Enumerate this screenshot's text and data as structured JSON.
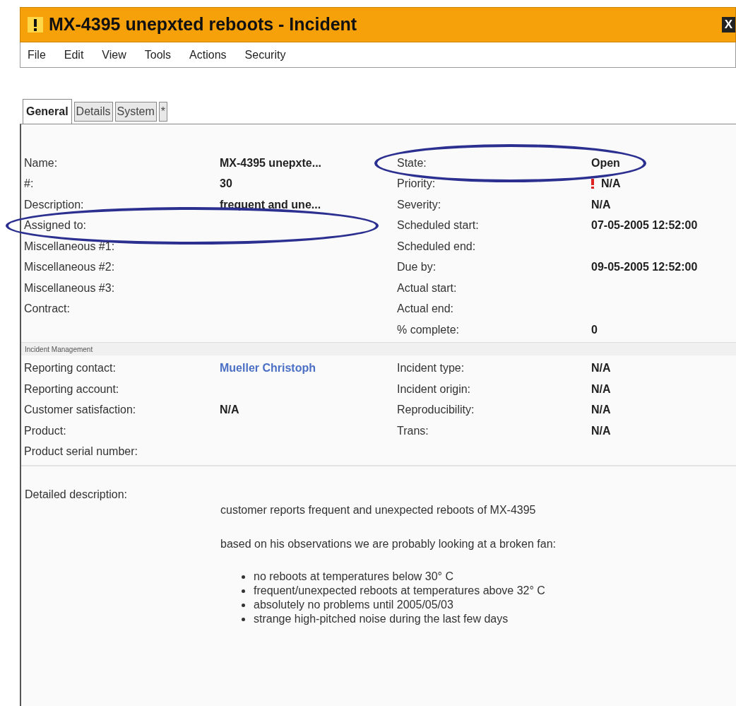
{
  "window": {
    "title": "MX-4395 unepxted reboots - Incident",
    "close_label": "X"
  },
  "menu": [
    "File",
    "Edit",
    "View",
    "Tools",
    "Actions",
    "Security"
  ],
  "tabs": [
    {
      "label": "General",
      "selected": true
    },
    {
      "label": "Details",
      "selected": false
    },
    {
      "label": "System",
      "selected": false
    },
    {
      "label": "*",
      "selected": false
    }
  ],
  "general": {
    "left": [
      {
        "label": "Name:",
        "value": "MX-4395 unepxte...",
        "circled": false
      },
      {
        "label": "#:",
        "value": "30",
        "circled": false
      },
      {
        "label": "Description:",
        "value": "frequent and une...",
        "circled": false
      },
      {
        "label": "Assigned to:",
        "circled": true
      },
      {
        "label": "Miscellaneous #1:",
        "circled": false
      },
      {
        "label": "Miscellaneous #2:",
        "circled": false
      },
      {
        "label": "Miscellaneous #3:",
        "circled": false
      },
      {
        "label": "Contract:",
        "circled": false
      }
    ],
    "right": [
      {
        "label": "State:",
        "value": "Open",
        "circled": true
      },
      {
        "label": "Priority:",
        "value": "N/A",
        "flag": true,
        "circled": false
      },
      {
        "label": "Severity:",
        "value": "N/A",
        "circled": false
      },
      {
        "label": "Scheduled start:",
        "value": "07-05-2005 12:52:00",
        "circled": false
      },
      {
        "label": "Scheduled end:",
        "circled": false
      },
      {
        "label": "Due by:",
        "value": "09-05-2005 12:52:00",
        "circled": false
      },
      {
        "label": "Actual start:",
        "circled": false
      },
      {
        "label": "Actual end:",
        "circled": false
      },
      {
        "label": "% complete:",
        "value": "0",
        "circled": false
      }
    ]
  },
  "incident_management": {
    "title": "Incident Management",
    "left": [
      {
        "label": "Reporting contact:",
        "value": "Mueller Christoph",
        "kind": "link"
      },
      {
        "label": "Reporting account:"
      },
      {
        "label": "Customer satisfaction:",
        "value": "N/A"
      },
      {
        "label": "Product:"
      },
      {
        "label": "Product serial number:"
      }
    ],
    "right": [
      {
        "label": "Incident type:",
        "value": "N/A"
      },
      {
        "label": "Incident origin:",
        "value": "N/A"
      },
      {
        "label": "Reproducibility:",
        "value": "N/A"
      },
      {
        "label": "Trans:",
        "value": "N/A"
      }
    ]
  },
  "detailed_description": {
    "label": "Detailed description:",
    "paragraphs": [
      "customer reports frequent and unexpected reboots of MX-4395",
      "based on his observations we are probably looking at a broken fan:"
    ],
    "bullets": [
      "no reboots at temperatures below 30° C",
      "frequent/unexpected reboots at temperatures above 32° C",
      "absolutely no problems until 2005/05/03",
      "strange high-pitched noise during the last few days"
    ]
  }
}
